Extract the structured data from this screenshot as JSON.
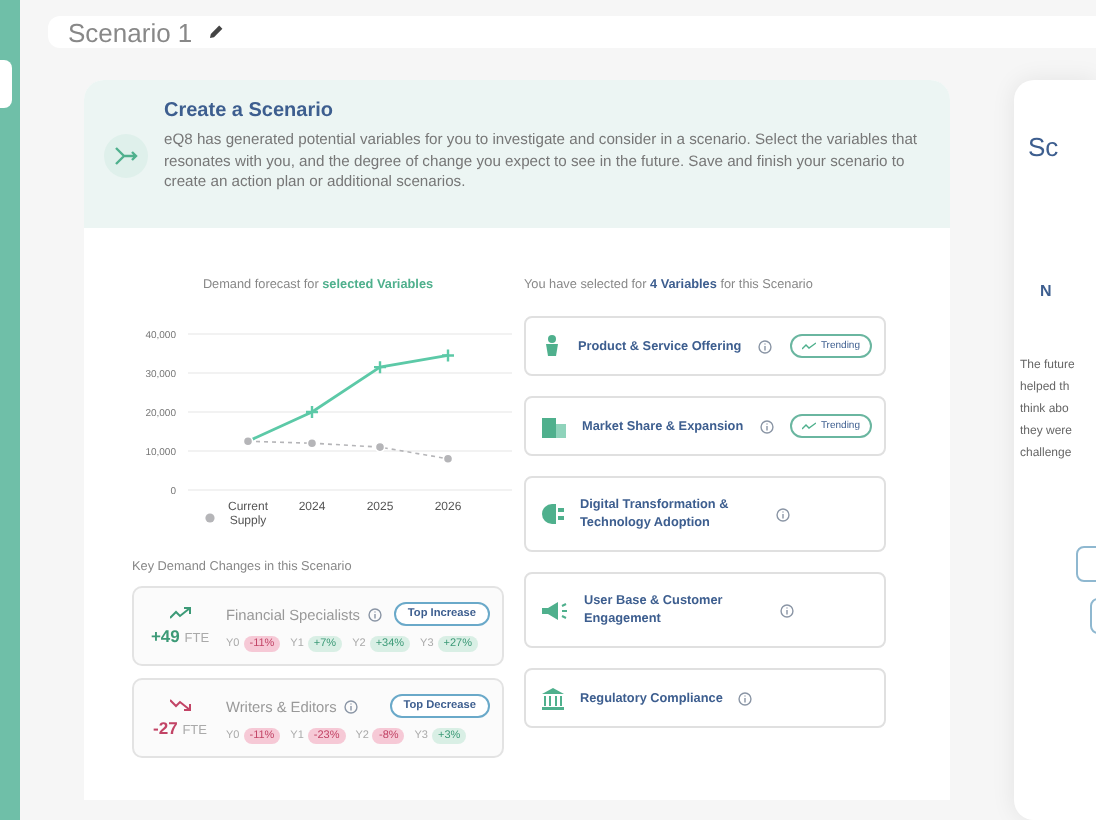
{
  "header": {
    "title": "Scenario 1"
  },
  "intro": {
    "title": "Create a Scenario",
    "text": "eQ8 has generated potential variables for you to investigate and consider in a scenario. Select the variables that resonates with you, and the degree of change you expect to see in the future. Save and finish your scenario to create an action plan or additional scenarios."
  },
  "forecast": {
    "title": "Demand forecast for **selected Variables**",
    "chart_data": {
      "type": "line",
      "categories": [
        "Current Supply",
        "2024",
        "2025",
        "2026"
      ],
      "ylim": [
        0,
        40000
      ],
      "grid": true,
      "yticks": [
        {
          "value": 0,
          "label": "0"
        },
        {
          "value": 10000,
          "label": "10,000"
        },
        {
          "value": 20000,
          "label": "20,000"
        },
        {
          "value": 30000,
          "label": "30,000"
        },
        {
          "value": 40000,
          "label": "40,000"
        }
      ],
      "series": [
        {
          "color": "#5cc9a7",
          "marker": "plus",
          "line_style": "solid",
          "values": [
            12500,
            20000,
            31500,
            34500
          ]
        },
        {
          "color": "#b5b5b8",
          "marker": "circle",
          "line_style": "dashed",
          "values": [
            12500,
            12000,
            11000,
            8000
          ]
        }
      ]
    }
  },
  "changes": {
    "title": "Key Demand Changes in this Scenario",
    "items": [
      {
        "kind": "up",
        "fte": "+49",
        "unit": "FTE",
        "title": "Financial Specialists",
        "badge": "Top Increase",
        "years": [
          {
            "label": "Y0",
            "value": "-11%",
            "kind": "negative"
          },
          {
            "label": "Y1",
            "value": "+7%",
            "kind": "positive"
          },
          {
            "label": "Y2",
            "value": "+34%",
            "kind": "positive"
          },
          {
            "label": "Y3",
            "value": "+27%",
            "kind": "positive"
          }
        ]
      },
      {
        "kind": "down",
        "fte": "-27",
        "unit": "FTE",
        "title": "Writers & Editors",
        "badge": "Top Decrease",
        "years": [
          {
            "label": "Y0",
            "value": "-11%",
            "kind": "negative"
          },
          {
            "label": "Y1",
            "value": "-23%",
            "kind": "negative"
          },
          {
            "label": "Y2",
            "value": "-8%",
            "kind": "negative"
          },
          {
            "label": "Y3",
            "value": "+3%",
            "kind": "positive"
          }
        ]
      }
    ]
  },
  "variables": {
    "title": "You have selected for **4 Variables** for this Scenario",
    "items": [
      {
        "label": "Product & Service Offering",
        "trending": true,
        "badge": "Trending"
      },
      {
        "label": "Market Share & Expansion",
        "trending": true,
        "badge": "Trending"
      },
      {
        "label": "Digital Transformation & Technology Adoption",
        "trending": false
      },
      {
        "label": "User Base & Customer Engagement",
        "trending": false
      },
      {
        "label": "Regulatory Compliance",
        "trending": false
      }
    ]
  },
  "side_dialog": {
    "title": "Sc",
    "subtitle": "N",
    "lines": [
      "The future",
      "helped th",
      "think abo",
      "they were",
      "challenge"
    ]
  }
}
